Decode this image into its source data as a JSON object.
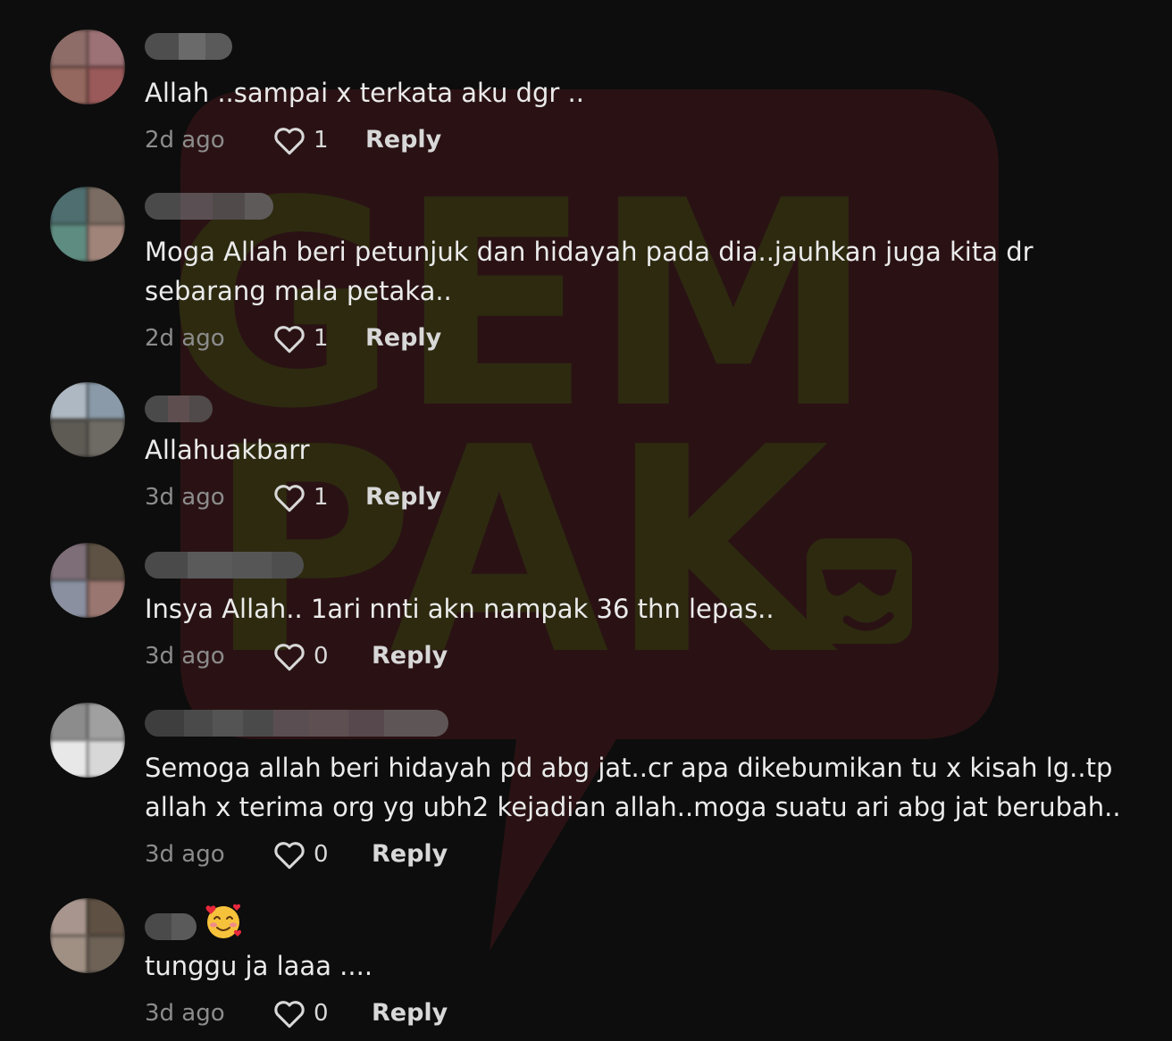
{
  "watermark": {
    "line1": "GEM",
    "line2": "PAK"
  },
  "comments": [
    {
      "text": "Allah ..sampai x terkata aku dgr ..",
      "time": "2d ago",
      "likes": "1",
      "reply_label": "Reply"
    },
    {
      "text": "Moga Allah beri petunjuk dan hidayah pada dia..jauhkan juga kita dr\nsebarang mala petaka..",
      "time": "2d ago",
      "likes": "1",
      "reply_label": "Reply"
    },
    {
      "text": "Allahuakbarr",
      "time": "3d ago",
      "likes": "1",
      "reply_label": "Reply"
    },
    {
      "text": "Insya Allah.. 1ari nnti akn nampak 36 thn lepas..",
      "time": "3d ago",
      "likes": "0",
      "reply_label": "Reply"
    },
    {
      "text": "Semoga allah beri hidayah pd abg jat..cr apa dikebumikan tu x kisah lg..tp\nallah x terima org yg ubh2 kejadian allah..moga suatu ari abg jat berubah..",
      "time": "3d ago",
      "likes": "0",
      "reply_label": "Reply"
    },
    {
      "text": "tunggu ja laaa ....",
      "time": "3d ago",
      "likes": "0",
      "reply_label": "Reply",
      "username_emoji": "smiling-face-with-hearts-icon"
    }
  ],
  "colors": {
    "background": "#0d0d0d",
    "text": "#ebebeb",
    "secondary_text": "#8c8c8c",
    "watermark_bubble": "#2a1214",
    "watermark_text": "#2d2a10"
  }
}
